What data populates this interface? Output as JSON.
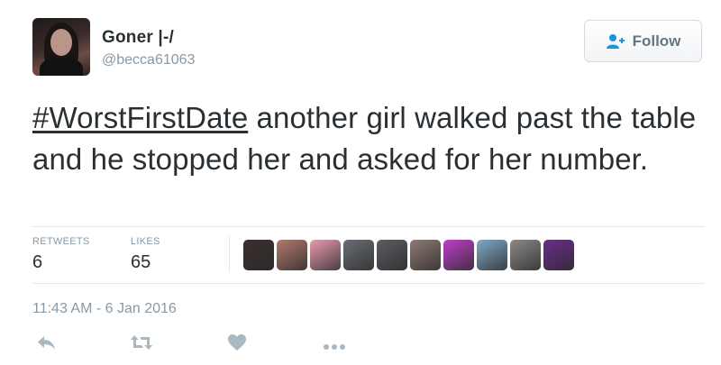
{
  "user": {
    "display_name": "Goner |-/",
    "handle": "@becca61063",
    "avatar_icon": "profile-photo"
  },
  "follow_button": {
    "label": "Follow",
    "icon": "add-user-icon"
  },
  "tweet": {
    "hashtag": "WorstFirstDate",
    "text_after_hashtag": " another girl walked past the table and he stopped her and asked for her number."
  },
  "stats": {
    "retweets_label": "RETWEETS",
    "retweets_value": "6",
    "likes_label": "LIKES",
    "likes_value": "65"
  },
  "likers": [
    {
      "name": "liker-avatar-1",
      "color": "#3a2f2d"
    },
    {
      "name": "liker-avatar-2",
      "color": "#b07a6e"
    },
    {
      "name": "liker-avatar-3",
      "color": "#e99bb0"
    },
    {
      "name": "liker-avatar-4",
      "color": "#6a6e74"
    },
    {
      "name": "liker-avatar-5",
      "color": "#5b5d63"
    },
    {
      "name": "liker-avatar-6",
      "color": "#8f7b74"
    },
    {
      "name": "liker-avatar-7",
      "color": "#c03ec9"
    },
    {
      "name": "liker-avatar-8",
      "color": "#7fa9c9"
    },
    {
      "name": "liker-avatar-9",
      "color": "#8c8a87"
    },
    {
      "name": "liker-avatar-10",
      "color": "#6a2e8a"
    }
  ],
  "timestamp": "11:43 AM - 6 Jan 2016",
  "actions": [
    "reply-icon",
    "retweet-icon",
    "like-icon",
    "more-icon"
  ],
  "colors": {
    "text": "#292f33",
    "muted": "#8899a6",
    "divider": "#e1e8ed",
    "action_gray": "#aab8c2"
  }
}
